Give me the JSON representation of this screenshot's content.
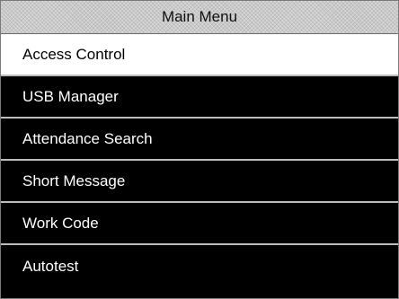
{
  "header": {
    "title": "Main Menu"
  },
  "menu": {
    "selected_index": 0,
    "items": [
      {
        "label": "Access Control"
      },
      {
        "label": "USB Manager"
      },
      {
        "label": "Attendance Search"
      },
      {
        "label": "Short Message"
      },
      {
        "label": "Work Code"
      },
      {
        "label": "Autotest"
      }
    ]
  },
  "colors": {
    "selected_background": "#ffffff",
    "item_background": "#000000",
    "title_background": "#c9c9c9",
    "divider": "#bdbdbd"
  }
}
